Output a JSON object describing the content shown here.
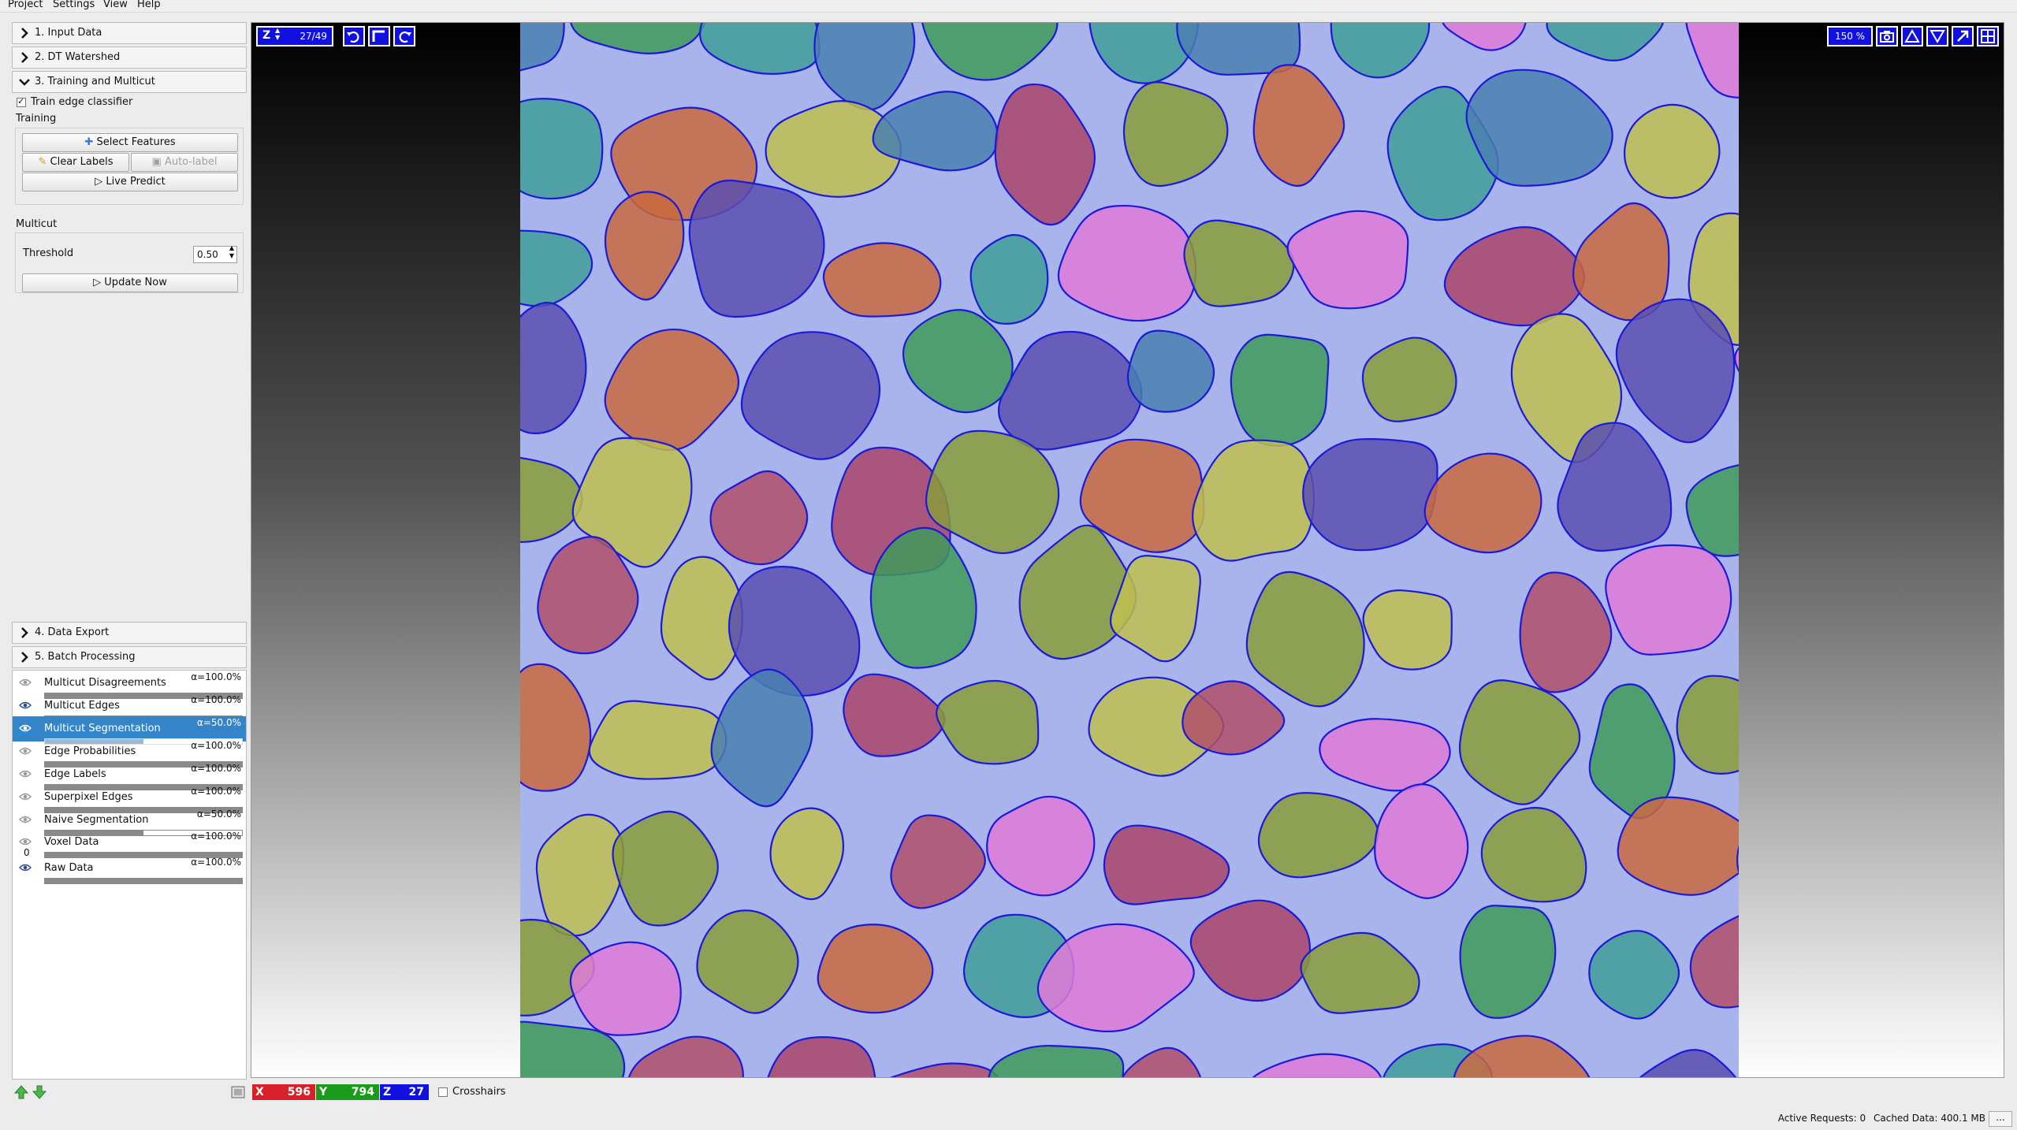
{
  "menu": {
    "items": [
      "Project",
      "Settings",
      "View",
      "Help"
    ]
  },
  "applets": {
    "input_data": "1. Input Data",
    "dt_watershed": "2. DT Watershed",
    "training": "3. Training and Multicut",
    "data_export": "4. Data Export",
    "batch": "5. Batch Processing"
  },
  "training": {
    "train_edge_classifier": "Train edge classifier",
    "train_checked": true,
    "section_label": "Training",
    "select_features": "Select Features",
    "clear_labels": "Clear Labels",
    "auto_label": "Auto-label",
    "live_predict": "Live Predict"
  },
  "multicut": {
    "section_label": "Multicut",
    "threshold_label": "Threshold",
    "threshold_value": "0.50",
    "update_now": "Update Now"
  },
  "layers": [
    {
      "name": "Multicut Disagreements",
      "alpha": "α=100.0%",
      "opacity": 1.0,
      "visible": false,
      "selected": false
    },
    {
      "name": "Multicut Edges",
      "alpha": "α=100.0%",
      "opacity": 1.0,
      "visible": true,
      "selected": false
    },
    {
      "name": "Multicut Segmentation",
      "alpha": "α=50.0%",
      "opacity": 0.5,
      "visible": true,
      "selected": true
    },
    {
      "name": "Edge Probabilities",
      "alpha": "α=100.0%",
      "opacity": 1.0,
      "visible": false,
      "selected": false
    },
    {
      "name": "Edge Labels",
      "alpha": "α=100.0%",
      "opacity": 1.0,
      "visible": false,
      "selected": false
    },
    {
      "name": "Superpixel Edges",
      "alpha": "α=100.0%",
      "opacity": 1.0,
      "visible": false,
      "selected": false
    },
    {
      "name": "Naive Segmentation",
      "alpha": "α=50.0%",
      "opacity": 0.5,
      "visible": false,
      "selected": false
    },
    {
      "name": "Voxel Data",
      "alpha": "α=100.0%",
      "opacity": 1.0,
      "visible": false,
      "selected": false,
      "channel": "0"
    },
    {
      "name": "Raw Data",
      "alpha": "α=100.0%",
      "opacity": 1.0,
      "visible": true,
      "selected": false
    }
  ],
  "viewer": {
    "axis": "Z",
    "slice": "27/49",
    "zoom": "150 %"
  },
  "coords": {
    "x_label": "X",
    "x_value": "596",
    "y_label": "Y",
    "y_value": "794",
    "z_label": "Z",
    "z_value": "27",
    "crosshairs": "Crosshairs",
    "crosshairs_checked": false
  },
  "status": {
    "active_requests": "Active Requests: 0",
    "cached_data": "Cached Data: 400.1 MB",
    "more": "..."
  },
  "colors": {
    "accent_blue": "#1010e0",
    "selection": "#3384c8",
    "coord_x": "#d8202a",
    "coord_y": "#1a9a1a",
    "coord_z": "#1010e0"
  },
  "segments": [
    {
      "color": "#4a7fb0",
      "shape": "cell"
    },
    {
      "color": "#c96a3f",
      "shape": "cell"
    },
    {
      "color": "#e07ad8",
      "shape": "cell"
    },
    {
      "color": "#3f9a5a",
      "shape": "cell"
    },
    {
      "color": "#c0c050",
      "shape": "cell"
    },
    {
      "color": "#a9446a",
      "shape": "cell"
    },
    {
      "color": "#3f9d9a",
      "shape": "cell"
    },
    {
      "color": "#5a4fb0",
      "shape": "cell"
    },
    {
      "color": "#8a9c3a",
      "shape": "cell"
    },
    {
      "color": "#b0506a",
      "shape": "cell"
    }
  ]
}
